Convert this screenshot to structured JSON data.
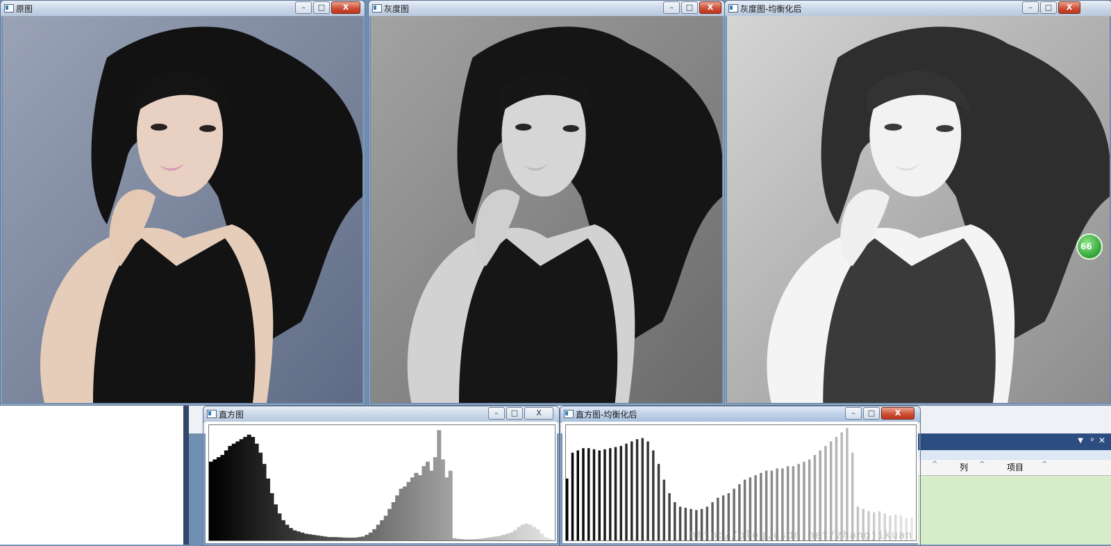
{
  "windows": {
    "original": {
      "title": "原图"
    },
    "gray": {
      "title": "灰度图"
    },
    "equalized": {
      "title": "灰度图-均衡化后"
    },
    "histogram": {
      "title": "直方图"
    },
    "histogram_eq": {
      "title": "直方图-均衡化后"
    }
  },
  "window_controls": {
    "minimize": "–",
    "maximize": "□",
    "close": "X"
  },
  "background_app": {
    "table_columns": [
      "列",
      "项目"
    ],
    "badge": "66",
    "watermark": "http://blog.csdn.net/zhangjikuan"
  },
  "chart_data": [
    {
      "type": "bar",
      "title": "直方图",
      "x": "gray level 0-255",
      "values": [
        0.7,
        0.72,
        0.74,
        0.76,
        0.8,
        0.84,
        0.86,
        0.88,
        0.9,
        0.92,
        0.94,
        0.92,
        0.86,
        0.78,
        0.68,
        0.55,
        0.42,
        0.32,
        0.24,
        0.18,
        0.14,
        0.11,
        0.09,
        0.08,
        0.07,
        0.06,
        0.055,
        0.05,
        0.045,
        0.04,
        0.035,
        0.03,
        0.03,
        0.03,
        0.028,
        0.026,
        0.025,
        0.025,
        0.025,
        0.03,
        0.035,
        0.05,
        0.07,
        0.1,
        0.14,
        0.18,
        0.22,
        0.28,
        0.34,
        0.4,
        0.46,
        0.48,
        0.52,
        0.56,
        0.6,
        0.58,
        0.66,
        0.7,
        0.62,
        0.74,
        0.98,
        0.72,
        0.56,
        0.62,
        0.02,
        0.015,
        0.012,
        0.01,
        0.01,
        0.01,
        0.012,
        0.015,
        0.02,
        0.025,
        0.03,
        0.035,
        0.04,
        0.05,
        0.06,
        0.07,
        0.09,
        0.12,
        0.14,
        0.15,
        0.14,
        0.12,
        0.1,
        0.06,
        0.03,
        0.02,
        0.0
      ]
    },
    {
      "type": "bar",
      "title": "直方图-均衡化后",
      "x": "gray level 0-255",
      "values": [
        0.55,
        0.78,
        0.8,
        0.82,
        0.82,
        0.81,
        0.8,
        0.81,
        0.82,
        0.83,
        0.84,
        0.86,
        0.88,
        0.9,
        0.91,
        0.88,
        0.8,
        0.68,
        0.54,
        0.42,
        0.34,
        0.3,
        0.29,
        0.28,
        0.27,
        0.28,
        0.3,
        0.34,
        0.38,
        0.4,
        0.42,
        0.46,
        0.5,
        0.54,
        0.56,
        0.58,
        0.6,
        0.62,
        0.62,
        0.64,
        0.64,
        0.66,
        0.66,
        0.68,
        0.7,
        0.72,
        0.76,
        0.8,
        0.84,
        0.88,
        0.92,
        0.96,
        1.0,
        0.78,
        0.3,
        0.28,
        0.26,
        0.25,
        0.26,
        0.24,
        0.22,
        0.23,
        0.22,
        0.2,
        0.2
      ]
    }
  ]
}
